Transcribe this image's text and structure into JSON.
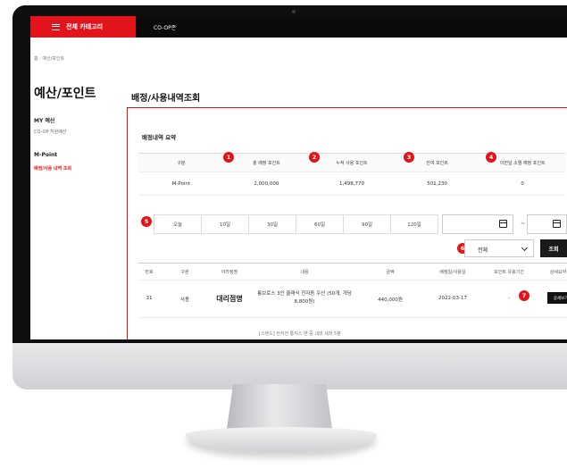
{
  "nav": {
    "category_label": "전체 카테고리",
    "coop_label": "CO-OP존"
  },
  "breadcrumb": "홈 · 예산/포인트",
  "sidebar": {
    "title": "예산/포인트",
    "groups": [
      {
        "heading": "MY 예산",
        "items": [
          "CO-OP 지원예산"
        ]
      },
      {
        "heading": "M-Point",
        "items": [
          "배정/사용 내역 조회"
        ]
      }
    ]
  },
  "page_title": "배정/사용내역조회",
  "summary": {
    "title": "배정내역 요약",
    "headers": [
      "구분",
      "총 배정 포인트",
      "누적 사용 포인트",
      "잔여 포인트",
      "이번달 소멸 예정 포인트"
    ],
    "row": [
      "M-Point",
      "2,000,000",
      "1,498,770",
      "501,230",
      "0"
    ]
  },
  "badges": [
    "1",
    "2",
    "3",
    "4",
    "5",
    "6",
    "7"
  ],
  "filter": {
    "periods": [
      "오늘",
      "10일",
      "30일",
      "60일",
      "90일",
      "120일"
    ],
    "date_separator": "~",
    "select_value": "전체",
    "search_label": "조회"
  },
  "table": {
    "headers": [
      "번호",
      "구분",
      "야라정명",
      "내용",
      "금액",
      "배정일/사용일",
      "포인트 유효기간",
      "상세요약"
    ],
    "rows": [
      {
        "no": "31",
        "type": "사용",
        "store": "대리점명",
        "content_line1": "롱브로스 3인 클래식 전자동 우산 (50개, 개당",
        "content_line2": "8,800원)",
        "amount": "440,000원",
        "date": "2022-03-17",
        "validity": "-",
        "detail_label": "상세보기"
      }
    ],
    "partial_next": "[스탠드] 전자전 통지스 벤 중 내외 세저 5분"
  },
  "colors": {
    "accent": "#e3131b",
    "dark": "#0a0a0a"
  }
}
